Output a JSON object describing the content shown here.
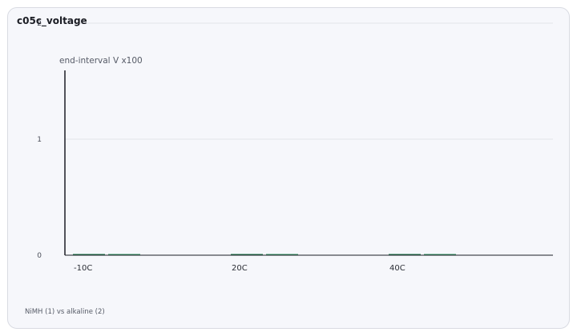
{
  "chart_data": {
    "type": "bar",
    "title": "c05c_voltage",
    "ylabel": "end-interval V x100",
    "xlabel": "",
    "categories": [
      "-10C",
      "20C",
      "40C"
    ],
    "series": [
      {
        "values": [
          0,
          0,
          0
        ],
        "color": "#1f7a4d"
      },
      {
        "values": [
          0,
          0,
          0
        ],
        "color": "#3a9a6a"
      }
    ],
    "ylim": [
      0,
      2
    ],
    "yticks": [
      0,
      1,
      2
    ],
    "grid": true,
    "legend_note": "NiMH (1) vs alkaline (2)"
  }
}
